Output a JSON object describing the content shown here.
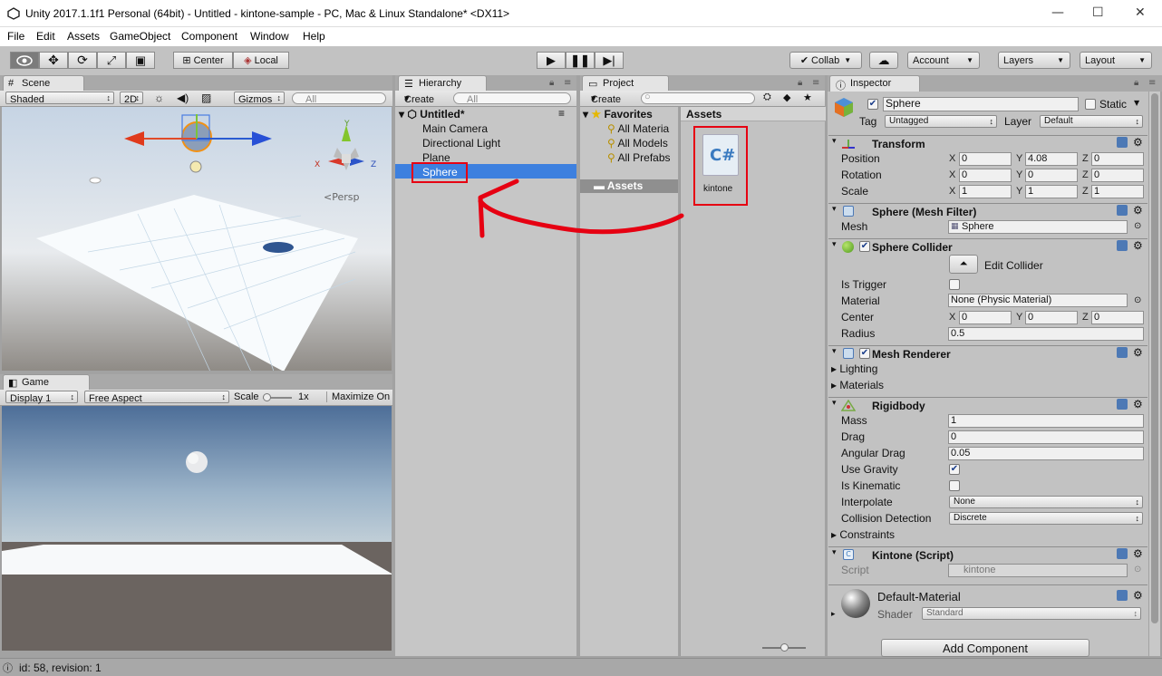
{
  "window": {
    "title": "Unity 2017.1.1f1 Personal (64bit) - Untitled - kintone-sample - PC, Mac & Linux Standalone* <DX11>",
    "minimize": "—",
    "maximize": "☐",
    "close": "✕"
  },
  "menu": [
    "File",
    "Edit",
    "Assets",
    "GameObject",
    "Component",
    "Window",
    "Help"
  ],
  "toolbar": {
    "center": "Center",
    "local": "Local",
    "collab": "Collab",
    "account": "Account",
    "layers": "Layers",
    "layout": "Layout"
  },
  "scene": {
    "tab": "Scene",
    "shading": "Shaded",
    "mode2d": "2D",
    "gizmos": "Gizmos",
    "search": "All",
    "persp": "Persp"
  },
  "game": {
    "tab": "Game",
    "display": "Display 1",
    "aspect": "Free Aspect",
    "scale_label": "Scale",
    "scale_value": "1x",
    "maximize": "Maximize On"
  },
  "hierarchy": {
    "tab": "Hierarchy",
    "create": "Create",
    "search": "All",
    "scene_name": "Untitled*",
    "items": [
      "Main Camera",
      "Directional Light",
      "Plane",
      "Sphere"
    ]
  },
  "project": {
    "tab": "Project",
    "create": "Create",
    "favorites": "Favorites",
    "fav_items": [
      "All Materia",
      "All Models",
      "All Prefabs"
    ],
    "assets_folder": "Assets",
    "assets_header": "Assets",
    "asset_file": "kintone"
  },
  "inspector": {
    "tab": "Inspector",
    "object_name": "Sphere",
    "static_label": "Static",
    "tag_label": "Tag",
    "tag_value": "Untagged",
    "layer_label": "Layer",
    "layer_value": "Default",
    "transform": {
      "title": "Transform",
      "position_label": "Position",
      "rotation_label": "Rotation",
      "scale_label": "Scale",
      "position": [
        "0",
        "4.08",
        "0"
      ],
      "rotation": [
        "0",
        "0",
        "0"
      ],
      "scale": [
        "1",
        "1",
        "1"
      ]
    },
    "mesh_filter": {
      "title": "Sphere (Mesh Filter)",
      "mesh_label": "Mesh",
      "mesh_value": "Sphere"
    },
    "collider": {
      "title": "Sphere Collider",
      "edit": "Edit Collider",
      "trigger_label": "Is Trigger",
      "material_label": "Material",
      "material_value": "None (Physic Material)",
      "center_label": "Center",
      "center": [
        "0",
        "0",
        "0"
      ],
      "radius_label": "Radius",
      "radius_value": "0.5"
    },
    "renderer": {
      "title": "Mesh Renderer",
      "lighting": "Lighting",
      "materials": "Materials"
    },
    "rigidbody": {
      "title": "Rigidbody",
      "mass_label": "Mass",
      "mass": "1",
      "drag_label": "Drag",
      "drag": "0",
      "angdrag_label": "Angular Drag",
      "angdrag": "0.05",
      "gravity_label": "Use Gravity",
      "kinematic_label": "Is Kinematic",
      "interp_label": "Interpolate",
      "interp": "None",
      "collision_label": "Collision Detection",
      "collision": "Discrete",
      "constraints": "Constraints"
    },
    "script": {
      "title": "Kintone (Script)",
      "label": "Script",
      "value": "kintone"
    },
    "material": {
      "name": "Default-Material",
      "shader_label": "Shader",
      "shader_value": "Standard"
    },
    "add_component": "Add Component"
  },
  "axes": {
    "x": "X",
    "y": "Y",
    "z": "Z"
  },
  "status": "id: 58, revision: 1",
  "colors": {
    "selection": "#3d80df",
    "annotation": "#e60012",
    "panel": "#c2c2c2"
  }
}
